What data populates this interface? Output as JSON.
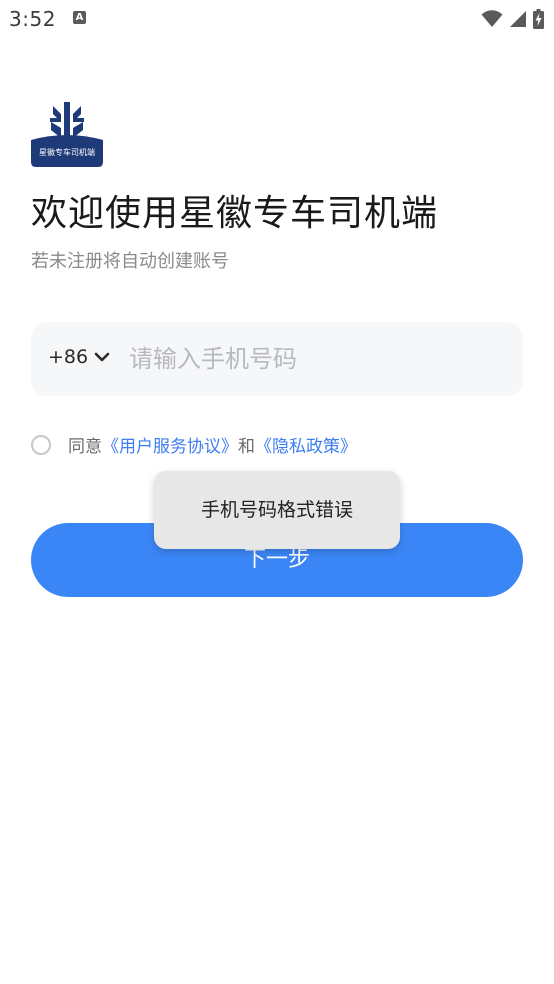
{
  "status_bar": {
    "time": "3:52",
    "notification_icon": "A",
    "icons": [
      "wifi-icon",
      "signal-icon",
      "battery-charging-icon"
    ]
  },
  "logo": {
    "text": "星徽专车司机端",
    "color": "#1f3a78"
  },
  "title": "欢迎使用星徽专车司机端",
  "subtitle": "若未注册将自动创建账号",
  "phone": {
    "country_code": "+86",
    "placeholder": "请输入手机号码",
    "value": ""
  },
  "agreement": {
    "checked": false,
    "prefix": "同意",
    "user_agreement": "《用户服务协议》",
    "and": "和",
    "privacy_policy": "《隐私政策》"
  },
  "next_button": {
    "label": "下一步",
    "color": "#3b86f7"
  },
  "toast": {
    "message": "手机号码格式错误"
  },
  "colors": {
    "link": "#3d7df2",
    "input_bg": "#f6f7f9"
  }
}
